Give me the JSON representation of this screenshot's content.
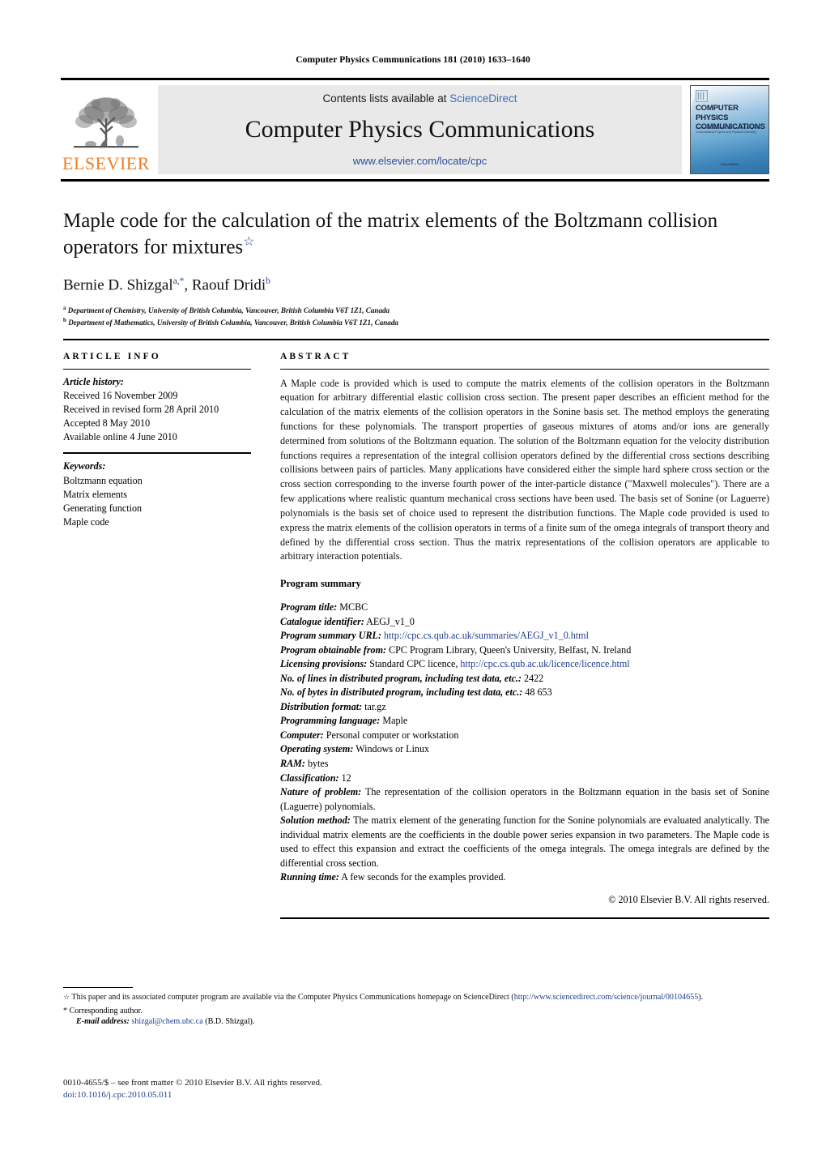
{
  "running_head": "Computer Physics Communications 181 (2010) 1633–1640",
  "header": {
    "contents_prefix": "Contents lists available at ",
    "sciencedirect": "ScienceDirect",
    "journal_name": "Computer Physics Communications",
    "journal_url": "www.elsevier.com/locate/cpc",
    "publisher_wordmark": "ELSEVIER",
    "publisher_color": "#ef7d22",
    "link_color": "#2b4d9b",
    "cover": {
      "title": "COMPUTER PHYSICS COMMUNICATIONS",
      "subtitle": "An International Journal and Program Library for Computational Physics and Physical Chemistry",
      "footer": "ScienceDirect"
    }
  },
  "article": {
    "title": "Maple code for the calculation of the matrix elements of the Boltzmann collision operators for mixtures",
    "title_footnote_marker": "☆",
    "authors": [
      {
        "name": "Bernie D. Shizgal",
        "marks": "a,*"
      },
      {
        "name": "Raouf Dridi",
        "marks": "b"
      }
    ],
    "affiliations": [
      {
        "mark": "a",
        "text": "Department of Chemistry, University of British Columbia, Vancouver, British Columbia V6T 1Z1, Canada"
      },
      {
        "mark": "b",
        "text": "Department of Mathematics, University of British Columbia, Vancouver, British Columbia V6T 1Z1, Canada"
      }
    ]
  },
  "info": {
    "heading": "ARTICLE INFO",
    "history_label": "Article history:",
    "history": [
      "Received 16 November 2009",
      "Received in revised form 28 April 2010",
      "Accepted 8 May 2010",
      "Available online 4 June 2010"
    ],
    "keywords_label": "Keywords:",
    "keywords": [
      "Boltzmann equation",
      "Matrix elements",
      "Generating function",
      "Maple code"
    ]
  },
  "abstract": {
    "heading": "ABSTRACT",
    "text": "A Maple code is provided which is used to compute the matrix elements of the collision operators in the Boltzmann equation for arbitrary differential elastic collision cross section. The present paper describes an efficient method for the calculation of the matrix elements of the collision operators in the Sonine basis set. The method employs the generating functions for these polynomials. The transport properties of gaseous mixtures of atoms and/or ions are generally determined from solutions of the Boltzmann equation. The solution of the Boltzmann equation for the velocity distribution functions requires a representation of the integral collision operators defined by the differential cross sections describing collisions between pairs of particles. Many applications have considered either the simple hard sphere cross section or the cross section corresponding to the inverse fourth power of the inter-particle distance (\"Maxwell molecules\"). There are a few applications where realistic quantum mechanical cross sections have been used. The basis set of Sonine (or Laguerre) polynomials is the basis set of choice used to represent the distribution functions. The Maple code provided is used to express the matrix elements of the collision operators in terms of a finite sum of the omega integrals of transport theory and defined by the differential cross section. Thus the matrix representations of the collision operators are applicable to arbitrary interaction potentials.",
    "program_summary_heading": "Program summary",
    "program_summary": [
      {
        "key": "Program title:",
        "value": "MCBC"
      },
      {
        "key": "Catalogue identifier:",
        "value": "AEGJ_v1_0"
      },
      {
        "key": "Program summary URL:",
        "value": "http://cpc.cs.qub.ac.uk/summaries/AEGJ_v1_0.html",
        "link": true
      },
      {
        "key": "Program obtainable from:",
        "value": "CPC Program Library, Queen's University, Belfast, N. Ireland"
      },
      {
        "key": "Licensing provisions:",
        "value": "Standard CPC licence, ",
        "value_link": "http://cpc.cs.qub.ac.uk/licence/licence.html"
      },
      {
        "key": "No. of lines in distributed program, including test data, etc.:",
        "value": "2422"
      },
      {
        "key": "No. of bytes in distributed program, including test data, etc.:",
        "value": "48 653"
      },
      {
        "key": "Distribution format:",
        "value": "tar.gz"
      },
      {
        "key": "Programming language:",
        "value": "Maple"
      },
      {
        "key": "Computer:",
        "value": "Personal computer or workstation"
      },
      {
        "key": "Operating system:",
        "value": "Windows or Linux"
      },
      {
        "key": "RAM:",
        "value": "bytes"
      },
      {
        "key": "Classification:",
        "value": "12"
      },
      {
        "key": "Nature of problem:",
        "value": "The representation of the collision operators in the Boltzmann equation in the basis set of Sonine (Laguerre) polynomials.",
        "para": true
      },
      {
        "key": "Solution method:",
        "value": "The matrix element of the generating function for the Sonine polynomials are evaluated analytically. The individual matrix elements are the coefficients in the double power series expansion in two parameters. The Maple code is used to effect this expansion and extract the coefficients of the omega integrals. The omega integrals are defined by the differential cross section.",
        "para": true
      },
      {
        "key": "Running time:",
        "value": "A few seconds for the examples provided."
      }
    ],
    "copyright": "© 2010 Elsevier B.V. All rights reserved."
  },
  "footnotes": {
    "star_marker": "☆",
    "star_text_pre": "This paper and its associated computer program are available via the Computer Physics Communications homepage on ScienceDirect (",
    "star_link": "http://www.sciencedirect.com/science/journal/00104655",
    "star_text_post": ").",
    "corresponding_marker": "*",
    "corresponding_text": "Corresponding author.",
    "email_label": "E-mail address:",
    "email": "shizgal@chem.ubc.ca",
    "email_suffix": "(B.D. Shizgal)."
  },
  "imprint": {
    "issn_line": "0010-4655/$ – see front matter  © 2010 Elsevier B.V. All rights reserved.",
    "doi": "doi:10.1016/j.cpc.2010.05.011"
  }
}
